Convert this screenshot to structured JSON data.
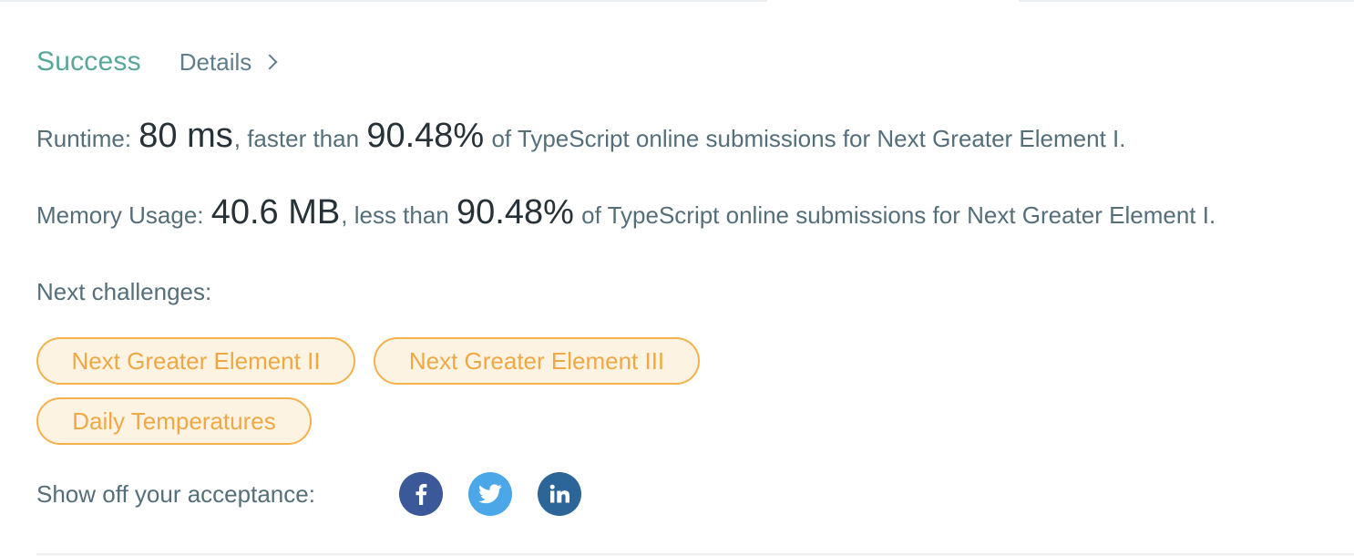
{
  "header": {
    "status": "Success",
    "details_label": "Details"
  },
  "runtime": {
    "label": "Runtime:",
    "value": "80 ms",
    "comparison": ", faster than",
    "percent": "90.48%",
    "suffix": "of TypeScript online submissions for Next Greater Element I."
  },
  "memory": {
    "label": "Memory Usage:",
    "value": "40.6 MB",
    "comparison": ", less than",
    "percent": "90.48%",
    "suffix": "of TypeScript online submissions for Next Greater Element I."
  },
  "next_challenges": {
    "label": "Next challenges:",
    "items": [
      "Next Greater Element II",
      "Next Greater Element III",
      "Daily Temperatures"
    ]
  },
  "share": {
    "label": "Show off your acceptance:",
    "icons": [
      "facebook-icon",
      "twitter-icon",
      "linkedin-icon"
    ]
  },
  "colors": {
    "success": "#58a89a",
    "chip_border": "#f2b24c",
    "chip_bg": "#fdf3e2",
    "chip_text": "#f0a844",
    "facebook": "#3b5998",
    "twitter": "#4ca7e8",
    "linkedin": "#2c6597"
  }
}
